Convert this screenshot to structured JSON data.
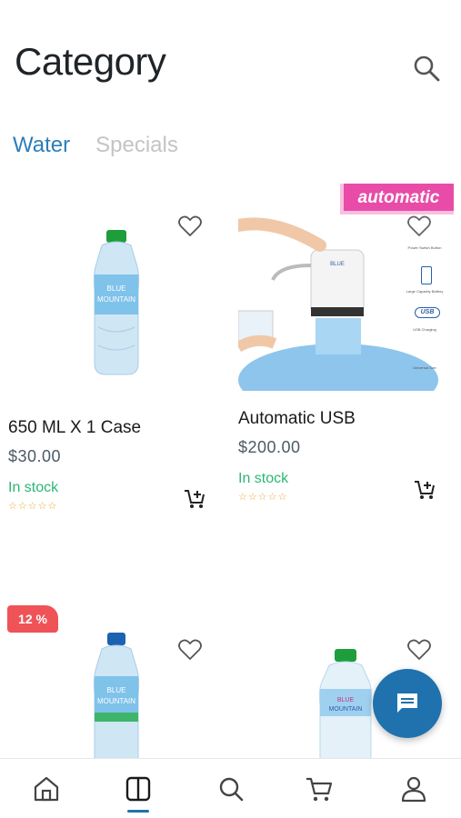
{
  "header": {
    "title": "Category"
  },
  "tabs": [
    {
      "label": "Water",
      "active": true
    },
    {
      "label": "Specials",
      "active": false
    }
  ],
  "products": [
    {
      "name": "650 ML X 1 Case",
      "price": "$30.00",
      "stock": "In stock",
      "rating_stars": "☆☆☆☆☆"
    },
    {
      "name": "Automatic USB",
      "price": "$200.00",
      "stock": "In stock",
      "rating_stars": "☆☆☆☆☆",
      "badge": "automatic",
      "image_text": [
        "Power Switch Button",
        "Large Capacity Battery",
        "USB",
        "USB Charging",
        "Universal Size"
      ]
    },
    {
      "badge": "12 %"
    },
    {}
  ],
  "bottle_label": [
    "BLUE",
    "MOUNTAIN"
  ],
  "colors": {
    "accent": "#1f72ad",
    "tab_active": "#2a7fb8",
    "stock": "#2bb673",
    "discount": "#ef5357",
    "automatic_badge": "#e84ca8"
  },
  "bottom_nav": [
    {
      "icon": "home-icon"
    },
    {
      "icon": "category-icon",
      "active": true
    },
    {
      "icon": "search-icon"
    },
    {
      "icon": "cart-icon"
    },
    {
      "icon": "profile-icon"
    }
  ],
  "fab": {
    "icon": "chat-icon"
  }
}
